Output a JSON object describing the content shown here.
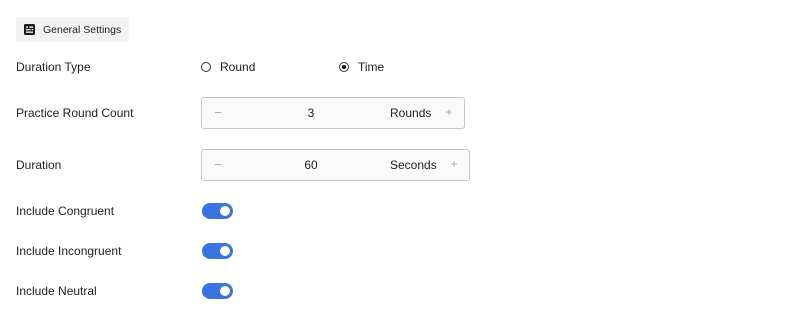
{
  "section": {
    "title": "General Settings",
    "icon": "settings-panel-icon"
  },
  "duration_type": {
    "label": "Duration Type",
    "options": [
      {
        "label": "Round",
        "checked": false
      },
      {
        "label": "Time",
        "checked": true
      }
    ]
  },
  "practice_round_count": {
    "label": "Practice Round Count",
    "value": "3",
    "unit": "Rounds",
    "decrement_icon": "minus-icon",
    "increment_icon": "plus-icon"
  },
  "duration": {
    "label": "Duration",
    "value": "60",
    "unit": "Seconds",
    "decrement_icon": "minus-icon",
    "increment_icon": "plus-icon"
  },
  "toggles": [
    {
      "label": "Include Congruent",
      "on": true
    },
    {
      "label": "Include Incongruent",
      "on": true
    },
    {
      "label": "Include Neutral",
      "on": true
    }
  ],
  "colors": {
    "accent": "#3b74e0",
    "tab_background": "#f2f2f2",
    "stepper_border": "#c7c7c7"
  }
}
